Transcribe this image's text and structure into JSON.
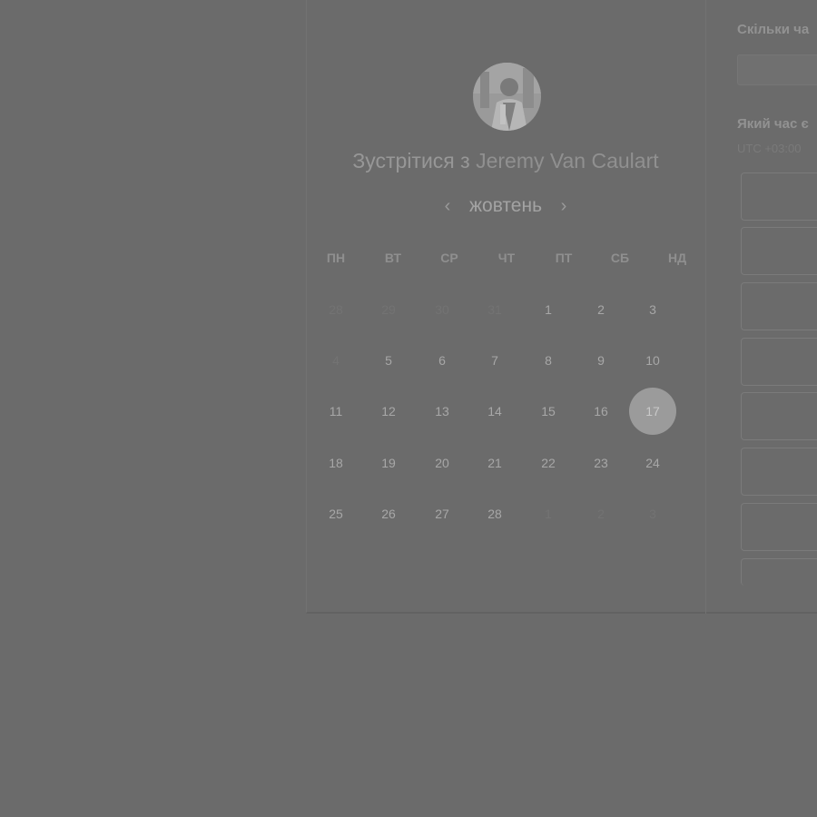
{
  "header": {
    "title_prefix": "Зустрітися з",
    "host_name": "Jeremy Van Caulart"
  },
  "calendar": {
    "month": "жовтень",
    "prev_icon": "‹",
    "next_icon": "›",
    "weekdays": [
      "ПН",
      "ВТ",
      "СР",
      "ЧТ",
      "ПТ",
      "СБ",
      "НД"
    ],
    "days": [
      {
        "label": "28",
        "muted": true
      },
      {
        "label": "29",
        "muted": true
      },
      {
        "label": "30",
        "muted": true
      },
      {
        "label": "31",
        "muted": true
      },
      {
        "label": "1"
      },
      {
        "label": "2"
      },
      {
        "label": "3"
      },
      {
        "label": "4",
        "muted": true
      },
      {
        "label": "5"
      },
      {
        "label": "6"
      },
      {
        "label": "7"
      },
      {
        "label": "8"
      },
      {
        "label": "9"
      },
      {
        "label": "10"
      },
      {
        "label": "11"
      },
      {
        "label": "12"
      },
      {
        "label": "13"
      },
      {
        "label": "14"
      },
      {
        "label": "15"
      },
      {
        "label": "16"
      },
      {
        "label": "17",
        "selected": true
      },
      {
        "label": "18"
      },
      {
        "label": "19"
      },
      {
        "label": "20"
      },
      {
        "label": "21"
      },
      {
        "label": "22"
      },
      {
        "label": "23"
      },
      {
        "label": "24"
      },
      {
        "label": "25"
      },
      {
        "label": "26"
      },
      {
        "label": "27"
      },
      {
        "label": "28"
      },
      {
        "label": "1",
        "muted": true
      },
      {
        "label": "2",
        "muted": true
      },
      {
        "label": "3",
        "muted": true
      }
    ]
  },
  "booking": {
    "duration_label": "Скільки ча",
    "time_label": "Який час є",
    "timezone": "UTC +03:00"
  }
}
